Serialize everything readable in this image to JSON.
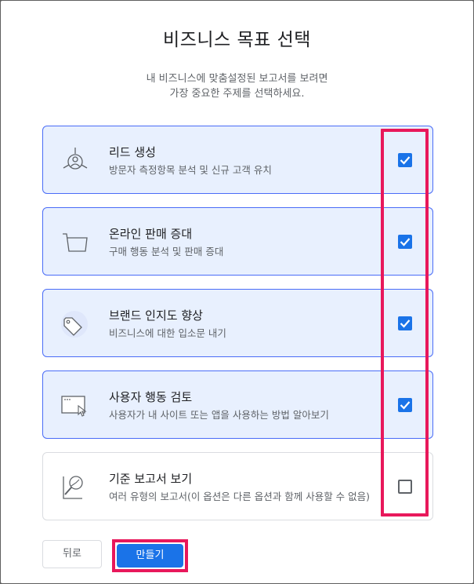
{
  "dialog": {
    "title": "비즈니스 목표 선택",
    "subtitle_line1": "내 비즈니스에 맞춤설정된 보고서를 보려면",
    "subtitle_line2": "가장 중요한 주제를 선택하세요."
  },
  "options": [
    {
      "name": "리드 생성",
      "desc": "방문자 측정항목 분석 및 신규 고객 유치",
      "checked": true,
      "icon": "target-person-icon"
    },
    {
      "name": "온라인 판매 증대",
      "desc": "구매 행동 분석 및 판매 증대",
      "checked": true,
      "icon": "shopping-cart-icon"
    },
    {
      "name": "브랜드 인지도 향상",
      "desc": "비즈니스에 대한 입소문 내기",
      "checked": true,
      "icon": "tag-icon"
    },
    {
      "name": "사용자 행동 검토",
      "desc": "사용자가 내 사이트 또는 앱을 사용하는 방법 알아보기",
      "checked": true,
      "icon": "browser-cursor-icon"
    },
    {
      "name": "기준 보고서 보기",
      "desc": "여러 유형의 보고서(이 옵션은 다른 옵션과 함께 사용할 수 없음)",
      "checked": false,
      "icon": "magnifier-report-icon"
    }
  ],
  "buttons": {
    "back": "뒤로",
    "create": "만들기"
  },
  "colors": {
    "accent": "#1a73e8",
    "selected_bg": "#e8f0fe",
    "highlight": "#e8185b"
  }
}
